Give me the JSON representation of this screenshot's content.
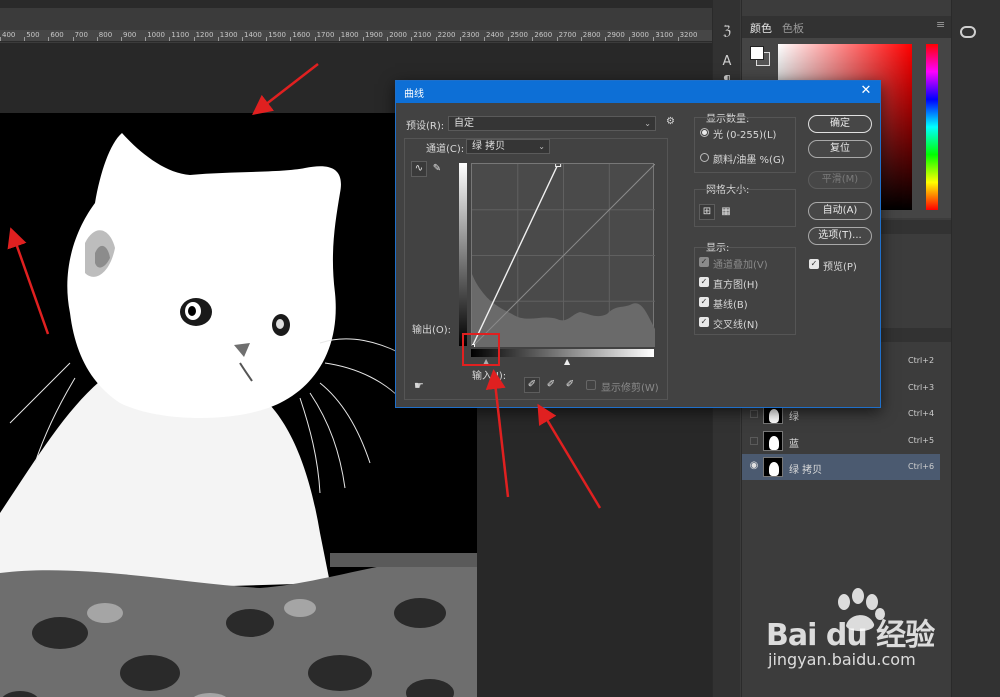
{
  "ruler": {
    "ticks": [
      "400",
      "500",
      "600",
      "700",
      "800",
      "900",
      "1000",
      "1100",
      "1200",
      "1300",
      "1400",
      "1500",
      "1600",
      "1700",
      "1800",
      "1900",
      "2000",
      "2100",
      "2200",
      "2300",
      "2400",
      "2500",
      "2600",
      "2700",
      "2800",
      "2900",
      "3000",
      "3100",
      "3200"
    ]
  },
  "color_panel": {
    "tab_active": "颜色",
    "tab_inactive": "色板"
  },
  "layers": [
    {
      "name": "",
      "shortcut": "Ctrl+2",
      "visible": false,
      "selected": false
    },
    {
      "name": "",
      "shortcut": "Ctrl+3",
      "visible": false,
      "selected": false
    },
    {
      "name": "绿",
      "shortcut": "Ctrl+4",
      "visible": false,
      "selected": false
    },
    {
      "name": "蓝",
      "shortcut": "Ctrl+5",
      "visible": false,
      "selected": false
    },
    {
      "name": "绿 拷贝",
      "shortcut": "Ctrl+6",
      "visible": true,
      "selected": true
    }
  ],
  "watermark": {
    "brand": "Bai du 经验",
    "url": "jingyan.baidu.com"
  },
  "dialog": {
    "title": "曲线",
    "preset_label": "预设(R):",
    "preset_value": "自定",
    "channel_label": "通道(C):",
    "channel_value": "绿 拷贝",
    "output_label": "输出(O):",
    "input_label": "输入(I):",
    "show_clipping_label": "显示修剪(W)",
    "display_amount": {
      "title": "显示数量:",
      "light": "光 (0-255)(L)",
      "pigment": "颜料/油墨 %(G)"
    },
    "grid_size_title": "网格大小:",
    "show": {
      "title": "显示:",
      "channel_overlay": "通道叠加(V)",
      "histogram": "直方图(H)",
      "baseline": "基线(B)",
      "intersection": "交叉线(N)"
    },
    "buttons": {
      "ok": "确定",
      "reset": "复位",
      "smooth": "平滑(M)",
      "auto": "自动(A)",
      "options": "选项(T)..."
    },
    "preview_label": "预览(P)",
    "curve_points": [
      [
        0,
        0
      ],
      [
        120,
        255
      ]
    ],
    "accent_color": "#0d6fd6",
    "annotation_color": "#e02020"
  }
}
